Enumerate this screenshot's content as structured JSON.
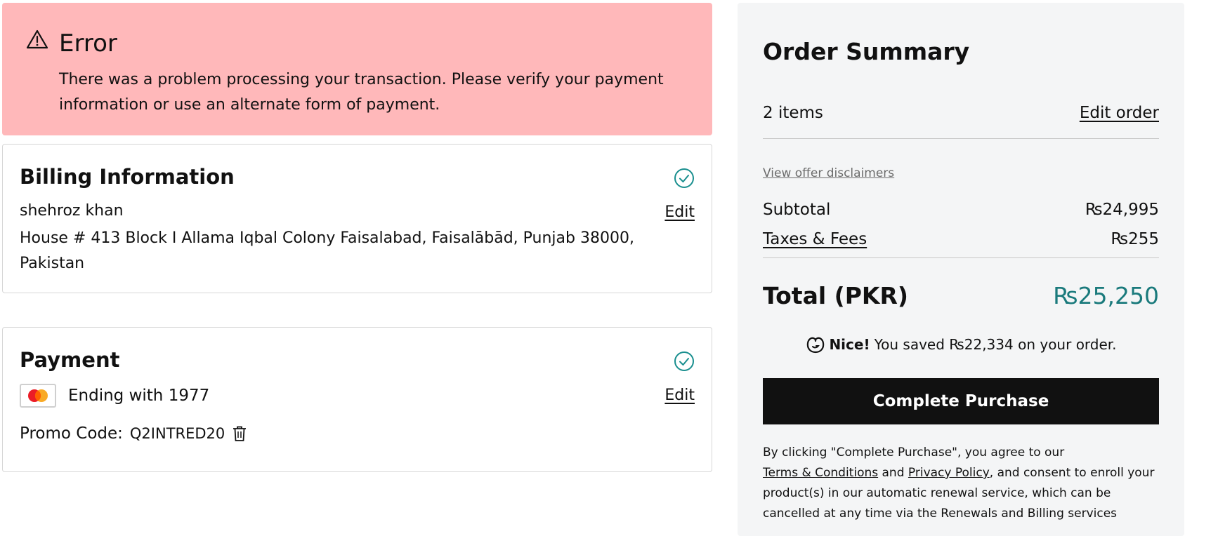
{
  "error": {
    "title": "Error",
    "message": "There was a problem processing your transaction. Please verify your payment information or use an alternate form of payment.",
    "background_color": "#ffb8ba"
  },
  "billing": {
    "title": "Billing Information",
    "name": "shehroz khan",
    "address": "House # 413 Block I Allama Iqbal Colony Faisalabad, Faisalābād, Punjab 38000, Pakistan",
    "edit_label": "Edit",
    "status_icon": "check-circle-icon"
  },
  "payment": {
    "title": "Payment",
    "card_brand_icon": "mastercard-icon",
    "ending_text": "Ending with 1977",
    "edit_label": "Edit",
    "promo_label": "Promo Code:",
    "promo_code": "Q2INTRED20",
    "remove_icon": "trash-icon",
    "status_icon": "check-circle-icon"
  },
  "summary": {
    "title": "Order Summary",
    "items_count": "2 items",
    "edit_order_label": "Edit order",
    "disclaimers_label": "View offer disclaimers",
    "subtotal_label": "Subtotal",
    "subtotal_value": "₨24,995",
    "taxes_label": "Taxes & Fees",
    "taxes_value": "₨255",
    "total_label": "Total (PKR)",
    "total_value": "₨25,250",
    "total_color": "#1a7a7c",
    "savings_icon": "godaddy-logo-icon",
    "savings_bold": "Nice!",
    "savings_text": "You saved ₨22,334 on your order.",
    "purchase_button": "Complete Purchase",
    "legal": {
      "prefix": "By clicking \"Complete Purchase\", you agree to our",
      "terms_link": "Terms & Conditions",
      "and": "and",
      "privacy_link": "Privacy Policy",
      "suffix": ", and consent to enroll your product(s) in our automatic renewal service, which can be cancelled at any time via the Renewals and Billing services"
    }
  },
  "accent_color": "#1a7a7c"
}
